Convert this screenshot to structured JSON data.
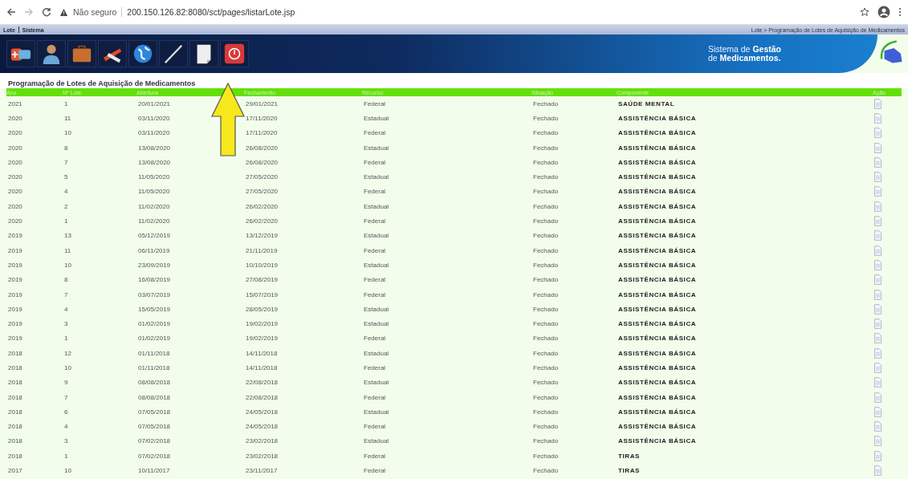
{
  "browser": {
    "security": "Não seguro",
    "url": "200.150.126.82:8080/sct/pages/listarLote.jsp"
  },
  "menu": [
    {
      "label": "Lote"
    },
    {
      "label": "Sistema"
    }
  ],
  "breadcrumb": "Lote > Programação de Lotes de Aquisição de Medicamentos",
  "toolbar": [
    {
      "kind": "pills"
    },
    {
      "kind": "person"
    },
    {
      "kind": "briefcase"
    },
    {
      "kind": "tools"
    },
    {
      "kind": "globe"
    },
    {
      "kind": "pen"
    },
    {
      "kind": "document"
    },
    {
      "kind": "power"
    }
  ],
  "banner": {
    "line1": "Sistema de",
    "line1_bold": "Gestão",
    "line2": "de",
    "line2_bold": "Medicamentos."
  },
  "page_title": "Programação de Lotes de Aquisição de Medicamentos",
  "table": {
    "columns": [
      "Ano",
      "Nº Lote",
      "Abertura",
      "Fechamento",
      "Recurso",
      "Situação",
      "Componente",
      "Ação"
    ],
    "rows": [
      [
        "2021",
        "1",
        "20/01/2021",
        "29/01/2021",
        "Federal",
        "Fechado",
        "SAÚDE MENTAL"
      ],
      [
        "2020",
        "11",
        "03/11/2020",
        "17/11/2020",
        "Estadual",
        "Fechado",
        "ASSISTÊNCIA BÁSICA"
      ],
      [
        "2020",
        "10",
        "03/11/2020",
        "17/11/2020",
        "Federal",
        "Fechado",
        "ASSISTÊNCIA BÁSICA"
      ],
      [
        "2020",
        "8",
        "13/08/2020",
        "26/08/2020",
        "Estadual",
        "Fechado",
        "ASSISTÊNCIA BÁSICA"
      ],
      [
        "2020",
        "7",
        "13/08/2020",
        "26/08/2020",
        "Federal",
        "Fechado",
        "ASSISTÊNCIA BÁSICA"
      ],
      [
        "2020",
        "5",
        "11/05/2020",
        "27/05/2020",
        "Estadual",
        "Fechado",
        "ASSISTÊNCIA BÁSICA"
      ],
      [
        "2020",
        "4",
        "11/05/2020",
        "27/05/2020",
        "Federal",
        "Fechado",
        "ASSISTÊNCIA BÁSICA"
      ],
      [
        "2020",
        "2",
        "11/02/2020",
        "26/02/2020",
        "Estadual",
        "Fechado",
        "ASSISTÊNCIA BÁSICA"
      ],
      [
        "2020",
        "1",
        "11/02/2020",
        "26/02/2020",
        "Federal",
        "Fechado",
        "ASSISTÊNCIA BÁSICA"
      ],
      [
        "2019",
        "13",
        "05/12/2019",
        "13/12/2019",
        "Estadual",
        "Fechado",
        "ASSISTÊNCIA BÁSICA"
      ],
      [
        "2019",
        "11",
        "06/11/2019",
        "21/11/2019",
        "Federal",
        "Fechado",
        "ASSISTÊNCIA BÁSICA"
      ],
      [
        "2019",
        "10",
        "23/09/2019",
        "10/10/2019",
        "Estadual",
        "Fechado",
        "ASSISTÊNCIA BÁSICA"
      ],
      [
        "2019",
        "8",
        "16/08/2019",
        "27/08/2019",
        "Federal",
        "Fechado",
        "ASSISTÊNCIA BÁSICA"
      ],
      [
        "2019",
        "7",
        "03/07/2019",
        "15/07/2019",
        "Federal",
        "Fechado",
        "ASSISTÊNCIA BÁSICA"
      ],
      [
        "2019",
        "4",
        "15/05/2019",
        "28/05/2019",
        "Estadual",
        "Fechado",
        "ASSISTÊNCIA BÁSICA"
      ],
      [
        "2019",
        "3",
        "01/02/2019",
        "19/02/2019",
        "Estadual",
        "Fechado",
        "ASSISTÊNCIA BÁSICA"
      ],
      [
        "2019",
        "1",
        "01/02/2019",
        "19/02/2019",
        "Federal",
        "Fechado",
        "ASSISTÊNCIA BÁSICA"
      ],
      [
        "2018",
        "12",
        "01/11/2018",
        "14/11/2018",
        "Estadual",
        "Fechado",
        "ASSISTÊNCIA BÁSICA"
      ],
      [
        "2018",
        "10",
        "01/11/2018",
        "14/11/2018",
        "Federal",
        "Fechado",
        "ASSISTÊNCIA BÁSICA"
      ],
      [
        "2018",
        "9",
        "08/08/2018",
        "22/08/2018",
        "Estadual",
        "Fechado",
        "ASSISTÊNCIA BÁSICA"
      ],
      [
        "2018",
        "7",
        "08/08/2018",
        "22/08/2018",
        "Federal",
        "Fechado",
        "ASSISTÊNCIA BÁSICA"
      ],
      [
        "2018",
        "6",
        "07/05/2018",
        "24/05/2018",
        "Estadual",
        "Fechado",
        "ASSISTÊNCIA BÁSICA"
      ],
      [
        "2018",
        "4",
        "07/05/2018",
        "24/05/2018",
        "Federal",
        "Fechado",
        "ASSISTÊNCIA BÁSICA"
      ],
      [
        "2018",
        "3",
        "07/02/2018",
        "23/02/2018",
        "Estadual",
        "Fechado",
        "ASSISTÊNCIA BÁSICA"
      ],
      [
        "2018",
        "1",
        "07/02/2018",
        "23/02/2018",
        "Federal",
        "Fechado",
        "TIRAS"
      ],
      [
        "2017",
        "10",
        "10/11/2017",
        "23/11/2017",
        "Federal",
        "Fechado",
        "TIRAS"
      ]
    ]
  }
}
